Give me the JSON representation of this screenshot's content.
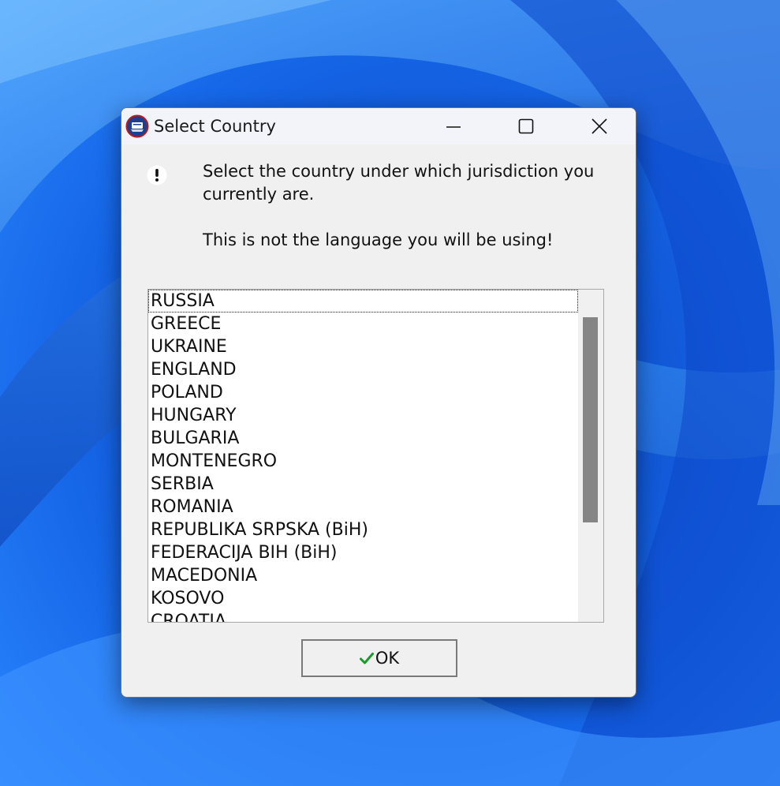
{
  "window": {
    "title": "Select Country",
    "controls": [
      "minimize",
      "maximize",
      "close"
    ]
  },
  "message": {
    "line1": "Select the country under which jurisdiction you currently are.",
    "line2": "This is not the language you will be using!"
  },
  "country_list": {
    "selected_index": 0,
    "items": [
      "RUSSIA",
      "GREECE",
      "UKRAINE",
      "ENGLAND",
      "POLAND",
      "HUNGARY",
      "BULGARIA",
      "MONTENEGRO",
      "SERBIA",
      "ROMANIA",
      "REPUBLIKA SRPSKA (BiH)",
      "FEDERACIJA BIH (BiH)",
      "MACEDONIA",
      "KOSOVO",
      "CROATIA"
    ]
  },
  "buttons": {
    "ok_label": "OK"
  },
  "icons": {
    "app": "app-logo-icon",
    "message": "exclamation-icon",
    "ok": "checkmark-icon"
  },
  "colors": {
    "wallpaper": "#1b6cf5",
    "dialog_background": "#f0f0f0",
    "scroll_thumb": "#858585",
    "checkmark": "#1a9a2a"
  }
}
